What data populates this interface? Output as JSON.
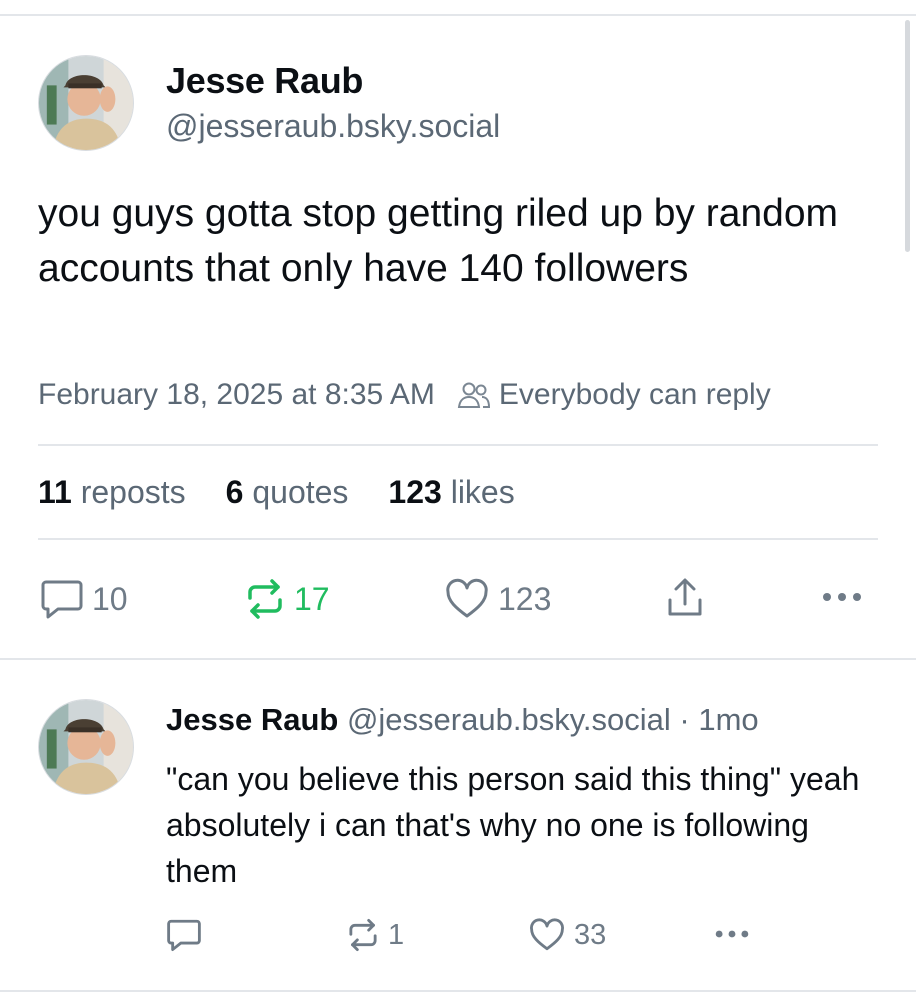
{
  "main_post": {
    "author_name": "Jesse Raub",
    "author_handle": "@jesseraub.bsky.social",
    "text": "you guys gotta stop getting riled up by random accounts that only have 140 followers",
    "timestamp": "February 18, 2025 at 8:35 AM",
    "reply_setting": "Everybody can reply",
    "stats": {
      "reposts_count": "11",
      "reposts_label": "reposts",
      "quotes_count": "6",
      "quotes_label": "quotes",
      "likes_count": "123",
      "likes_label": "likes"
    },
    "actions": {
      "reply_count": "10",
      "repost_count": "17",
      "like_count": "123",
      "share_icon": "share-icon",
      "more_icon": "more-icon"
    },
    "colors": {
      "reposted_accent": "#20bc5f",
      "muted": "#6f7b87"
    }
  },
  "reply_post": {
    "author_name": "Jesse Raub",
    "author_handle": "@jesseraub.bsky.social",
    "separator": "·",
    "time_ago": "1mo",
    "text": "\"can you believe this person said this thing\" yeah absolutely i can that's why no one is following them",
    "actions": {
      "repost_count": "1",
      "like_count": "33"
    }
  }
}
